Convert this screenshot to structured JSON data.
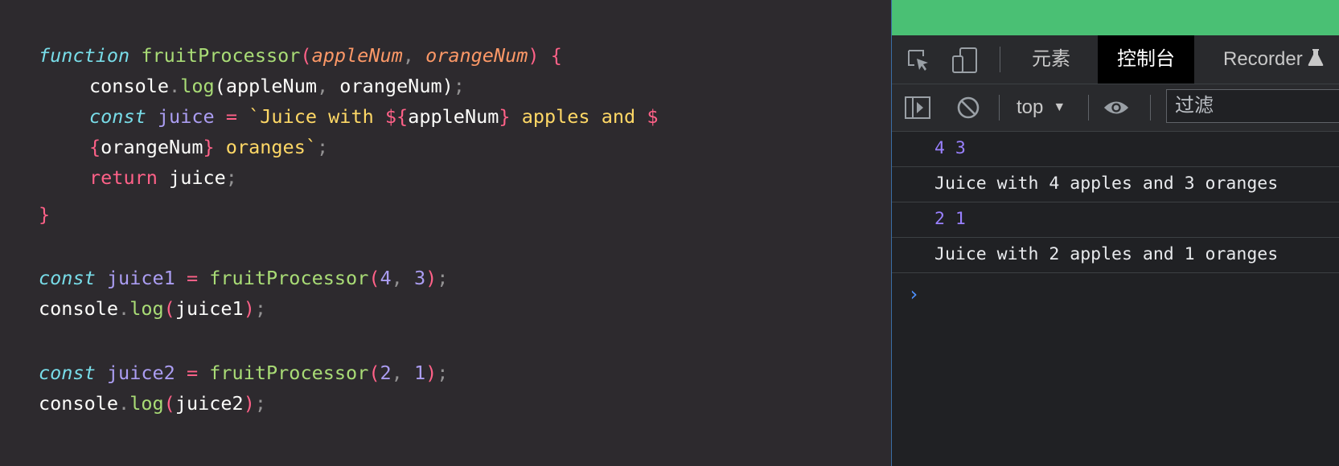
{
  "editor": {
    "line1": {
      "kw": "function",
      "fn": "fruitProcessor",
      "open_paren": "(",
      "p1": "appleNum",
      "comma": ", ",
      "p2": "orangeNum",
      "close_paren": ")",
      "brace": " {"
    },
    "line2": {
      "obj": "console",
      "dot": ".",
      "method": "log",
      "open": "(",
      "args": "appleNum",
      "comma": ", ",
      "args2": "orangeNum",
      "close": ")",
      "semi": ";"
    },
    "line3": {
      "kw": "const",
      "var": "juice",
      "op": "=",
      "str1": "`Juice with ",
      "interp_open": "${",
      "expr1": "appleNum",
      "interp_close": "}",
      "str2": " apples and ",
      "dollar": "$"
    },
    "line4": {
      "brace_open": "{",
      "expr2": "orangeNum",
      "brace_close": "}",
      "str3": " oranges`",
      "semi": ";"
    },
    "line5": {
      "kw": "return",
      "var": "juice",
      "semi": ";"
    },
    "line6": {
      "brace": "}"
    },
    "line8": {
      "kw": "const",
      "var": "juice1",
      "op": "=",
      "fn": "fruitProcessor",
      "open": "(",
      "n1": "4",
      "comma": ", ",
      "n2": "3",
      "close": ")",
      "semi": ";"
    },
    "line9": {
      "obj": "console",
      "dot": ".",
      "method": "log",
      "open": "(",
      "arg": "juice1",
      "close": ")",
      "semi": ";"
    },
    "line11": {
      "kw": "const",
      "var": "juice2",
      "op": "=",
      "fn": "fruitProcessor",
      "open": "(",
      "n1": "2",
      "comma": ", ",
      "n2": "1",
      "close": ")",
      "semi": ";"
    },
    "line12": {
      "obj": "console",
      "dot": ".",
      "method": "log",
      "open": "(",
      "arg": "juice2",
      "close": ")",
      "semi": ";"
    }
  },
  "devtools": {
    "tabs": [
      {
        "label": "元素",
        "active": false
      },
      {
        "label": "控制台",
        "active": true
      },
      {
        "label": "Recorder",
        "active": false
      }
    ],
    "icons": {
      "inspect": "inspect-element-icon",
      "device": "device-toolbar-icon",
      "sidebar": "sidebar-toggle-icon",
      "clear": "clear-console-icon",
      "eye": "live-expression-icon",
      "recorder": "flask-icon"
    },
    "context": "top",
    "caret": "▼",
    "filter_placeholder": "过滤",
    "messages": [
      {
        "text": "4 3",
        "kind": "number"
      },
      {
        "text": "Juice with 4 apples and 3 oranges",
        "kind": "string"
      },
      {
        "text": "2 1",
        "kind": "number"
      },
      {
        "text": "Juice with 2 apples and 1 oranges",
        "kind": "string"
      }
    ],
    "prompt": "›"
  },
  "colors": {
    "editor_bg": "#2d2a2e",
    "keyword": "#78dce8",
    "function": "#a9dc76",
    "param": "#fc9867",
    "string": "#ffd866",
    "number": "#ab9df2",
    "accent_pink": "#ff6188",
    "devtools_bg": "#202124",
    "green_bar": "#4ac074",
    "console_number": "#9980ff"
  }
}
